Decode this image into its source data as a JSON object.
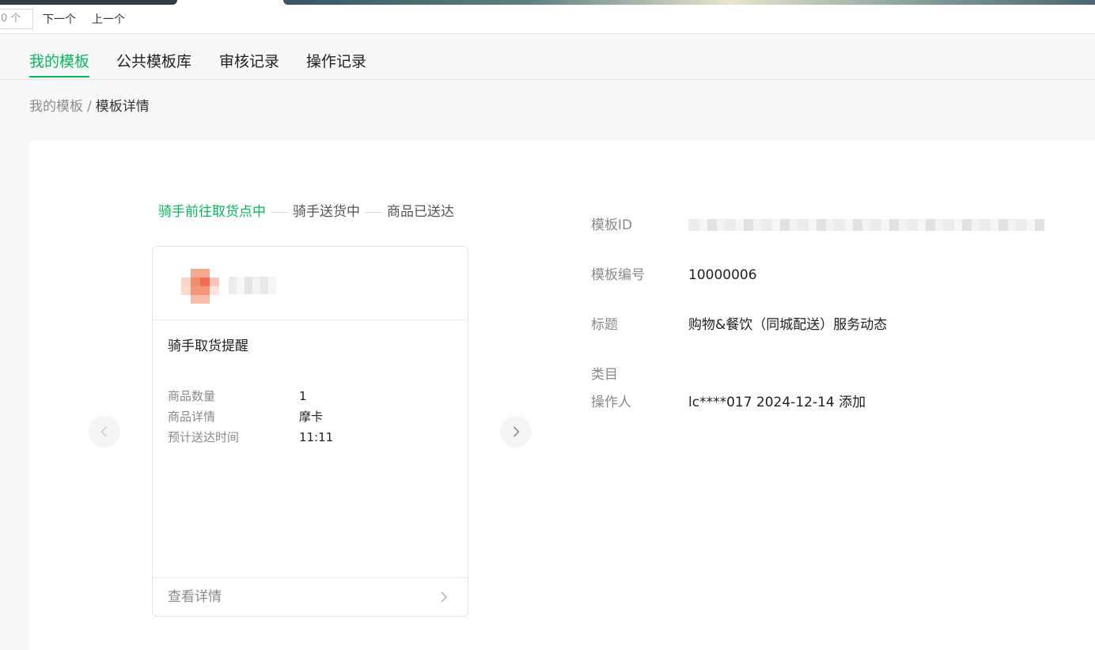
{
  "findbar": {
    "count_text": "0 个",
    "next_label": "下一个",
    "prev_label": "上一个"
  },
  "tabs": [
    {
      "label": "我的模板",
      "active": true
    },
    {
      "label": "公共模板库",
      "active": false
    },
    {
      "label": "审核记录",
      "active": false
    },
    {
      "label": "操作记录",
      "active": false
    }
  ],
  "breadcrumb": {
    "parent": "我的模板",
    "separator": "/",
    "current": "模板详情"
  },
  "steps": [
    {
      "label": "骑手前往取货点中",
      "active": true
    },
    {
      "label": "骑手送货中",
      "active": false
    },
    {
      "label": "商品已送达",
      "active": false
    }
  ],
  "card": {
    "title": "骑手取货提醒",
    "fields": [
      {
        "key": "商品数量",
        "value": "1"
      },
      {
        "key": "商品详情",
        "value": "摩卡"
      },
      {
        "key": "预计送达时间",
        "value": "11:11"
      }
    ],
    "footer_label": "查看详情"
  },
  "info": {
    "template_id_label": "模板ID",
    "template_no_label": "模板编号",
    "template_no": "10000006",
    "title_label": "标题",
    "title": "购物&餐饮（同城配送）服务动态",
    "category_label": "类目",
    "operator_label": "操作人",
    "operator": "lc****017 2024-12-14 添加"
  },
  "colors": {
    "accent": "#07b859",
    "muted_text": "#8a8a8a"
  },
  "icons": {
    "prev": "chevron-left-icon",
    "next": "chevron-right-icon",
    "footer": "chevron-right-icon"
  }
}
